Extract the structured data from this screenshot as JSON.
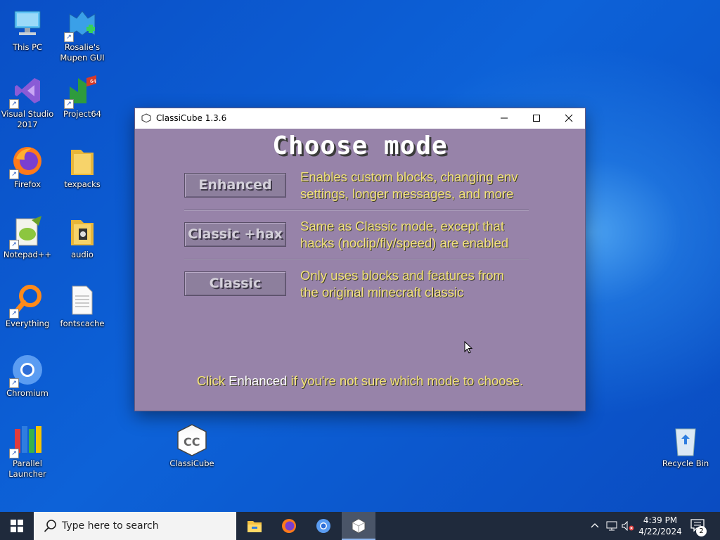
{
  "desktop": {
    "icons": [
      {
        "label": "This PC"
      },
      {
        "label": "Rosalie's Mupen GUI"
      },
      {
        "label": "Visual Studio 2017"
      },
      {
        "label": "Project64"
      },
      {
        "label": "Firefox"
      },
      {
        "label": "texpacks"
      },
      {
        "label": "Notepad++"
      },
      {
        "label": "audio"
      },
      {
        "label": "Everything"
      },
      {
        "label": "fontscache"
      },
      {
        "label": "Chromium"
      },
      {
        "label": "Parallel Launcher"
      },
      {
        "label": "ClassiCube"
      },
      {
        "label": "Recycle Bin"
      }
    ]
  },
  "window": {
    "title": "ClassiCube 1.3.6",
    "heading": "Choose mode",
    "modes": [
      {
        "button": "Enhanced",
        "desc_line1": "Enables custom blocks, changing env",
        "desc_line2": "settings, longer messages, and more"
      },
      {
        "button": "Classic +hax",
        "desc_line1": "Same as Classic mode, except that",
        "desc_line2": "hacks (noclip/fly/speed) are enabled"
      },
      {
        "button": "Classic",
        "desc_line1": "Only uses blocks and features from",
        "desc_line2": "the original minecraft classic"
      }
    ],
    "footer": {
      "part1": "Click ",
      "highlight": "Enhanced",
      "part2": " if you're not sure which mode to choose."
    }
  },
  "taskbar": {
    "search_placeholder": "Type here to search",
    "time": "4:39 PM",
    "date": "4/22/2024",
    "notification_count": "2"
  },
  "colors": {
    "window_bg": "#9783a9",
    "desc_text": "#f3e27a",
    "taskbar": "#1f2a3c",
    "desktop": "#0d62d8"
  }
}
